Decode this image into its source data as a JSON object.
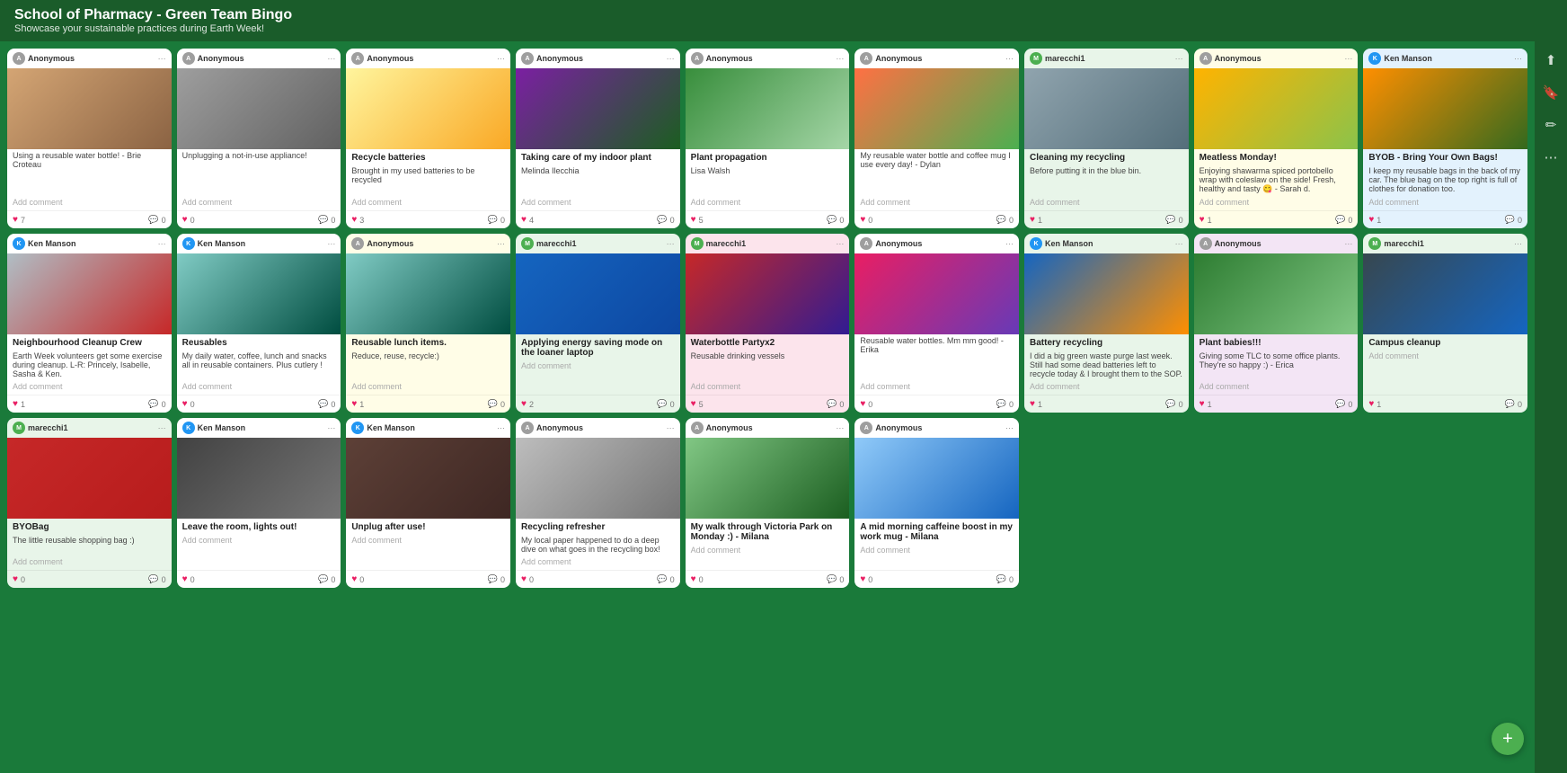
{
  "header": {
    "title": "School of Pharmacy - Green Team Bingo",
    "subtitle": "Showcase your sustainable practices during Earth Week!"
  },
  "fab": {
    "label": "+"
  },
  "sidebar_icons": [
    "share",
    "bookmark",
    "edit",
    "more"
  ],
  "cards": [
    {
      "id": 1,
      "user": "Anonymous",
      "user_color": "#9e9e9e",
      "badge": "",
      "title": "",
      "desc": "Using a reusable water bottle! - Brie Croteau",
      "img_class": "img-tan",
      "likes": 7,
      "comments": 0,
      "card_class": "white",
      "col": 1
    },
    {
      "id": 2,
      "user": "Anonymous",
      "user_color": "#9e9e9e",
      "badge": "",
      "title": "",
      "desc": "Unplugging a not-in-use appliance!",
      "img_class": "img-gray",
      "likes": 0,
      "comments": 0,
      "card_class": "white",
      "col": 2
    },
    {
      "id": 3,
      "user": "Anonymous",
      "user_color": "#9e9e9e",
      "badge": "",
      "title": "Recycle batteries",
      "desc": "Brought in my used batteries to be recycled",
      "img_class": "img-yellow",
      "likes": 3,
      "comments": 0,
      "card_class": "white",
      "col": 3
    },
    {
      "id": 4,
      "user": "Anonymous",
      "user_color": "#9e9e9e",
      "badge": "",
      "title": "Taking care of my indoor plant",
      "desc": "Melinda Ilecchia",
      "img_class": "img-purple-plant",
      "likes": 4,
      "comments": 0,
      "card_class": "white",
      "col": 4
    },
    {
      "id": 5,
      "user": "Anonymous",
      "user_color": "#9e9e9e",
      "badge": "",
      "title": "Plant propagation",
      "desc": "Lisa Walsh",
      "img_class": "img-green-plant",
      "likes": 5,
      "comments": 0,
      "card_class": "white",
      "col": 5
    },
    {
      "id": 6,
      "user": "Anonymous",
      "user_color": "#9e9e9e",
      "badge": "",
      "title": "",
      "desc": "My reusable water bottle and coffee mug I use every day! - Dylan",
      "img_class": "img-orange-bottle",
      "likes": 0,
      "comments": 0,
      "card_class": "white",
      "col": 6
    },
    {
      "id": 7,
      "user": "marecchi1",
      "user_color": "#4caf50",
      "badge": "",
      "title": "Cleaning my recycling",
      "desc": "Before putting it in the blue bin.",
      "img_class": "img-sink",
      "likes": 1,
      "comments": 0,
      "card_class": "light-green",
      "col": 7
    },
    {
      "id": 8,
      "user": "Anonymous",
      "user_color": "#9e9e9e",
      "badge": "",
      "title": "Meatless Monday!",
      "desc": "Enjoying shawarma spiced portobello wrap with coleslaw on the side! Fresh, healthy and tasty 😋 - Sarah d.",
      "img_class": "img-food",
      "likes": 1,
      "comments": 0,
      "card_class": "light-yellow",
      "col": 8
    },
    {
      "id": 9,
      "user": "Ken Manson",
      "user_color": "#2196f3",
      "badge": "",
      "title": "BYOB - Bring Your Own Bags!",
      "desc": "I keep my reusable bags in the back of my car. The blue bag on the top right is full of clothes for donation too.",
      "img_class": "img-bags",
      "likes": 1,
      "comments": 0,
      "card_class": "light-blue",
      "col": 9
    },
    {
      "id": 10,
      "user": "Ken Manson",
      "user_color": "#2196f3",
      "badge": "",
      "title": "Neighbourhood Cleanup Crew",
      "desc": "Earth Week volunteers get some exercise during cleanup. L-R: Princely, Isabelle, Sasha & Ken.",
      "img_class": "img-neighbourhood",
      "likes": 1,
      "comments": 0,
      "card_class": "white",
      "col": 1
    },
    {
      "id": 11,
      "user": "Ken Manson",
      "user_color": "#2196f3",
      "badge": "",
      "title": "Reusables",
      "desc": "My daily water, coffee, lunch and snacks all in reusable containers. Plus cutlery !",
      "img_class": "img-containers",
      "likes": 0,
      "comments": 0,
      "card_class": "white",
      "col": 2
    },
    {
      "id": 12,
      "user": "Anonymous",
      "user_color": "#9e9e9e",
      "badge": "",
      "title": "Reusable lunch items.",
      "desc": "Reduce, reuse, recycle:)",
      "img_class": "img-containers",
      "likes": 1,
      "comments": 0,
      "card_class": "light-yellow",
      "col": 3
    },
    {
      "id": 13,
      "user": "marecchi1",
      "user_color": "#4caf50",
      "badge": "",
      "title": "Applying energy saving mode on the loaner laptop",
      "desc": "",
      "img_class": "img-screen",
      "likes": 2,
      "comments": 0,
      "card_class": "light-green",
      "col": 4
    },
    {
      "id": 14,
      "user": "marecchi1",
      "user_color": "#4caf50",
      "badge": "",
      "title": "Waterbottle Partyx2",
      "desc": "Reusable drinking vessels",
      "img_class": "img-waterloo",
      "likes": 5,
      "comments": 0,
      "card_class": "pink",
      "col": 5
    },
    {
      "id": 15,
      "user": "Anonymous",
      "user_color": "#9e9e9e",
      "badge": "",
      "title": "",
      "desc": "Reusable water bottles. Mm mm good! -Erika",
      "img_class": "img-bottles",
      "likes": 0,
      "comments": 0,
      "card_class": "white",
      "col": 6
    },
    {
      "id": 16,
      "user": "Ken Manson",
      "user_color": "#2196f3",
      "badge": "",
      "title": "Battery recycling",
      "desc": "I did a big green waste purge last week. Still had some dead batteries left to recycle today & I brought them to the SOP.",
      "img_class": "img-batteries",
      "likes": 1,
      "comments": 0,
      "card_class": "light-green",
      "col": 7
    },
    {
      "id": 17,
      "user": "Anonymous",
      "user_color": "#9e9e9e",
      "badge": "",
      "title": "Plant babies!!!",
      "desc": "Giving some TLC to some office plants. They're so happy :) - Erica",
      "img_class": "img-plant-babies",
      "likes": 1,
      "comments": 0,
      "card_class": "light-purple",
      "col": 8
    },
    {
      "id": 18,
      "user": "marecchi1",
      "user_color": "#4caf50",
      "badge": "",
      "title": "Campus cleanup",
      "desc": "",
      "img_class": "img-cleanup",
      "likes": 1,
      "comments": 0,
      "card_class": "light-green",
      "col": 9
    },
    {
      "id": 19,
      "user": "marecchi1",
      "user_color": "#4caf50",
      "badge": "",
      "title": "BYOBag",
      "desc": "The little reusable shopping bag :)",
      "img_class": "img-byobag",
      "likes": 0,
      "comments": 0,
      "card_class": "light-green",
      "col": 1
    },
    {
      "id": 20,
      "user": "Ken Manson",
      "user_color": "#2196f3",
      "badge": "",
      "title": "Leave the room, lights out!",
      "desc": "",
      "img_class": "img-lightswitch",
      "likes": 0,
      "comments": 0,
      "card_class": "white",
      "col": 2
    },
    {
      "id": 21,
      "user": "Ken Manson",
      "user_color": "#2196f3",
      "badge": "",
      "title": "Unplug after use!",
      "desc": "",
      "img_class": "img-unplug",
      "likes": 0,
      "comments": 0,
      "card_class": "white",
      "col": 3
    },
    {
      "id": 22,
      "user": "Anonymous",
      "user_color": "#9e9e9e",
      "badge": "",
      "title": "Recycling refresher",
      "desc": "My local paper happened to do a deep dive on what goes in the recycling box!",
      "img_class": "img-newspaper",
      "likes": 0,
      "comments": 0,
      "card_class": "white",
      "col": 4
    },
    {
      "id": 23,
      "user": "Anonymous",
      "user_color": "#9e9e9e",
      "badge": "",
      "title": "My walk through Victoria Park on Monday :) - Milana",
      "desc": "",
      "img_class": "img-park",
      "likes": 0,
      "comments": 0,
      "card_class": "white",
      "col": 5
    },
    {
      "id": 24,
      "user": "Anonymous",
      "user_color": "#9e9e9e",
      "badge": "",
      "title": "A mid morning caffeine boost in my work mug - Milana",
      "desc": "",
      "img_class": "img-mug",
      "likes": 0,
      "comments": 0,
      "card_class": "white",
      "col": 6
    }
  ],
  "add_comment_label": "Add comment",
  "labels": {
    "heart": "♥",
    "menu": "⋯",
    "comment": "💬"
  }
}
